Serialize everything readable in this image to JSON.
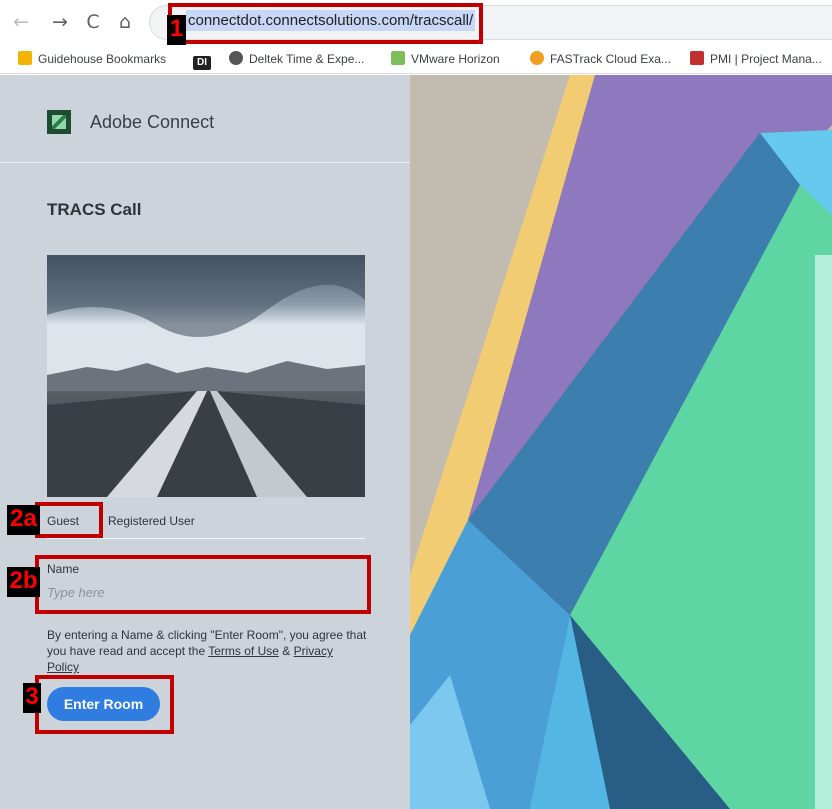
{
  "browser": {
    "url": "connectdot.connectsolutions.com/tracscall/",
    "bookmarks": [
      {
        "label": "Guidehouse Bookmarks",
        "color": "#f4b400"
      },
      {
        "label": "",
        "color": "#333333"
      },
      {
        "label": "Deltek Time & Expe...",
        "color": "#555555"
      },
      {
        "label": "VMware Horizon",
        "color": "#7fbf5a"
      },
      {
        "label": "FASTrack Cloud Exa...",
        "color": "#f0a020"
      },
      {
        "label": "PMI | Project Mana...",
        "color": "#c03030"
      }
    ],
    "bookmark_icon_text": "DI"
  },
  "brand": {
    "name": "Adobe Connect"
  },
  "meeting": {
    "title": "TRACS Call"
  },
  "login_tabs": {
    "guest": "Guest",
    "registered": "Registered User"
  },
  "name_field": {
    "label": "Name",
    "placeholder": "Type here",
    "value": ""
  },
  "agreement": {
    "prefix": "By entering a Name & clicking \"Enter Room\", you agree that you have read and accept the",
    "terms": "Terms of Use",
    "and": "&",
    "privacy": "Privacy Policy"
  },
  "actions": {
    "enter_room": "Enter Room"
  },
  "annotations": {
    "step1": "1",
    "step2a": "2a",
    "step2b": "2b",
    "step3": "3",
    "color": "#c00000"
  }
}
